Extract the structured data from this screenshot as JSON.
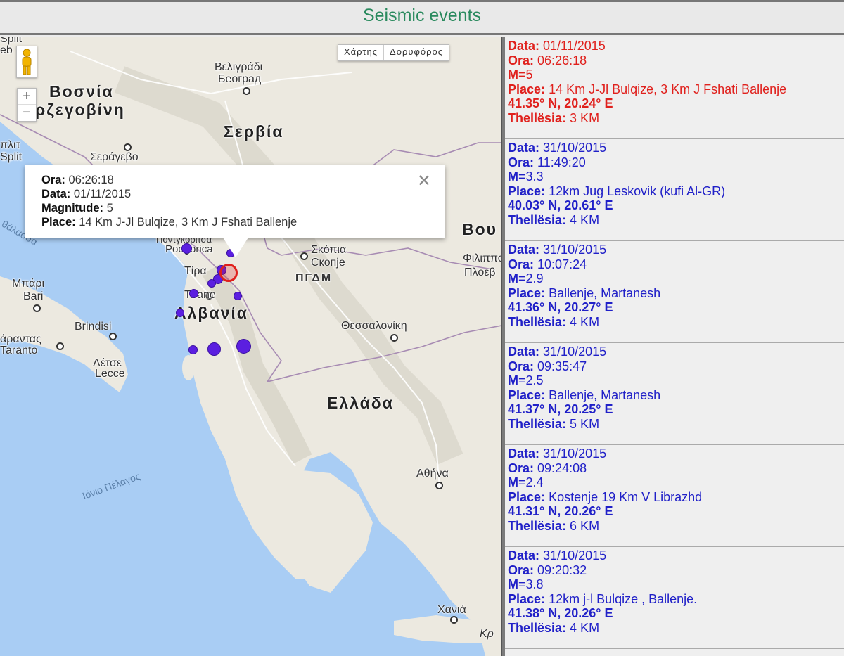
{
  "header": {
    "title": "Seismic events"
  },
  "map": {
    "type_buttons": [
      "Χάρτης",
      "Δορυφόρος"
    ],
    "zoom_in": "+",
    "zoom_out": "−",
    "labels": {
      "split_top": "Split",
      "eb": "eb",
      "bosnia1": "Βοσνία",
      "bosnia2": "ρζεγοβίνη",
      "belgrade_gr": "Βελιγράδι",
      "belgrade_sr": "Београд",
      "serbia": "Σερβία",
      "split_gr": "πλιτ",
      "split": "Split",
      "sarajevo": "Σεράγεβο",
      "sea_adr": "θάλασσα",
      "podgorica_gr": "Ποντγκόριτσα",
      "podgorica": "Podgorica",
      "tirana_gr": "Τίρα",
      "tirana": "Tirane",
      "skopje_gr": "Σκόπια",
      "skopje": "Скопје",
      "fyrom": "ΠΓΔΜ",
      "bou": "Βου",
      "filip": "Φιλιππο",
      "plov": "Πλοεβ",
      "bari_gr": "Μπάρι",
      "bari": "Bari",
      "albania": "Αλβανία",
      "brindisi": "Brindisi",
      "taranto_gr": "άραντας",
      "taranto": "Taranto",
      "lecce_gr": "Λέτσε",
      "lecce": "Lecce",
      "thessaloniki": "Θεσσαλονίκη",
      "greece": "Ελλάδα",
      "ionian": "Ιόνιο Πέλαγος",
      "athens": "Αθήνα",
      "chania": "Χανιά",
      "kr": "Κρ"
    },
    "popup": {
      "ora_label": "Ora:",
      "ora": "06:26:18",
      "data_label": "Data:",
      "data": "01/11/2015",
      "mag_label": "Magnitude:",
      "mag": "5",
      "place_label": "Place:",
      "place": "14 Km J-Jl Bulqize, 3 Km J Fshati Ballenje",
      "close": "✕"
    }
  },
  "events": [
    {
      "data": "01/11/2015",
      "ora": "06:26:18",
      "m": "5",
      "place": "14 Km J-Jl Bulqize, 3 Km J Fshati Ballenje",
      "coords": "41.35° N, 20.24° E",
      "depth": "3 KM",
      "color": "#e0201c"
    },
    {
      "data": "31/10/2015",
      "ora": "11:49:20",
      "m": "3.3",
      "place": "12km Jug Leskovik (kufi Al-GR)",
      "coords": "40.03° N, 20.61° E",
      "depth": "4 KM",
      "color": "#2020c8"
    },
    {
      "data": "31/10/2015",
      "ora": "10:07:24",
      "m": "2.9",
      "place": "Ballenje, Martanesh",
      "coords": "41.36° N, 20.27° E",
      "depth": "4 KM",
      "color": "#2020c8"
    },
    {
      "data": "31/10/2015",
      "ora": "09:35:47",
      "m": "2.5",
      "place": "Ballenje, Martanesh",
      "coords": "41.37° N, 20.25° E",
      "depth": "5 KM",
      "color": "#2020c8"
    },
    {
      "data": "31/10/2015",
      "ora": "09:24:08",
      "m": "2.4",
      "place": "Kostenje 19 Km V Librazhd",
      "coords": "41.31° N, 20.26° E",
      "depth": "6 KM",
      "color": "#2020c8"
    },
    {
      "data": "31/10/2015",
      "ora": "09:20:32",
      "m": "3.8",
      "place": "12km j-l Bulqize , Ballenje.",
      "coords": "41.38° N, 20.26° E",
      "depth": "4 KM",
      "color": "#2020c8"
    }
  ],
  "event_labels": {
    "data": "Data:",
    "ora": "Ora:",
    "m": "M",
    "place": "Place:",
    "depth": "Thellësia:"
  }
}
